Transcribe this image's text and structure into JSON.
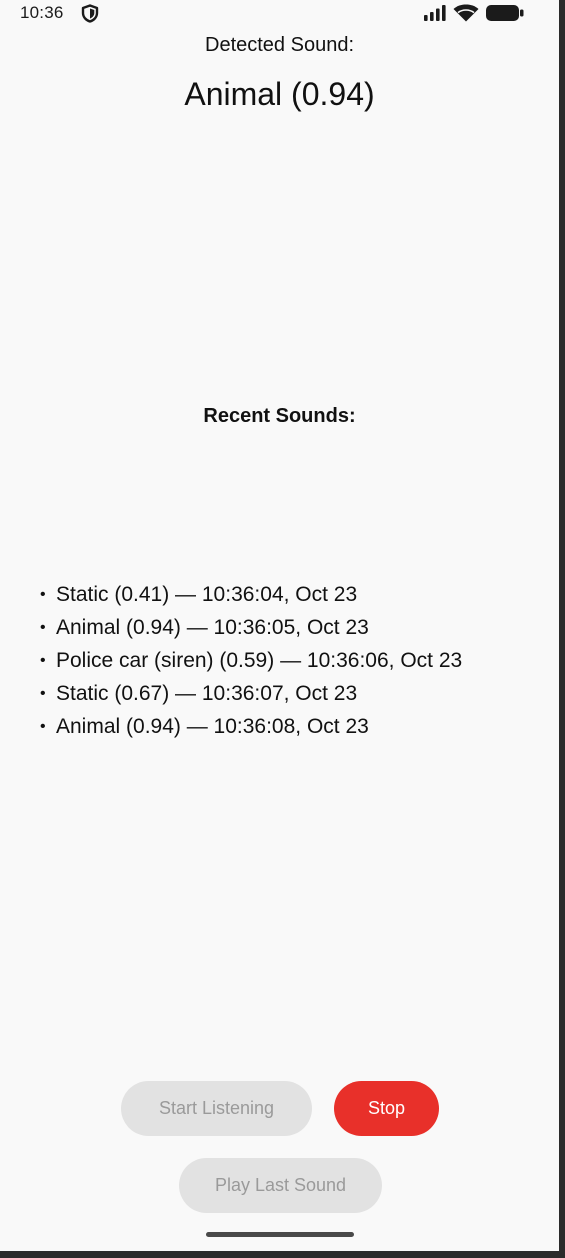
{
  "status_bar": {
    "time": "10:36",
    "icons": [
      "shield-icon",
      "signal-icon",
      "wifi-icon",
      "battery-icon"
    ]
  },
  "detected": {
    "label": "Detected Sound:",
    "value": "Animal (0.94)"
  },
  "recent": {
    "label": "Recent Sounds:",
    "bullet": "•",
    "items": [
      "Static (0.41) — 10:36:04, Oct 23",
      "Animal (0.94) — 10:36:05, Oct 23",
      "Police car (siren) (0.59) — 10:36:06, Oct 23",
      "Static (0.67) — 10:36:07, Oct 23",
      "Animal (0.94) — 10:36:08, Oct 23"
    ]
  },
  "buttons": {
    "start": "Start Listening",
    "stop": "Stop",
    "play_last": "Play Last Sound"
  },
  "colors": {
    "stop_button": "#e8302a",
    "disabled_button": "#e2e2e2",
    "disabled_text": "#9a9a9a",
    "background": "#f9f9f9"
  }
}
